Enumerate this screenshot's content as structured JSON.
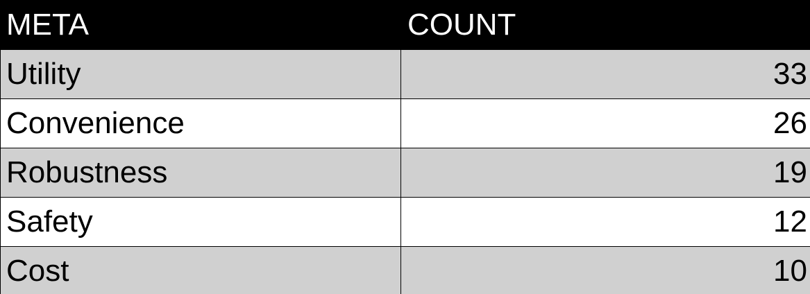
{
  "chart_data": {
    "type": "table",
    "columns": [
      "META",
      "COUNT"
    ],
    "rows": [
      {
        "label": "Utility",
        "value": "33"
      },
      {
        "label": "Convenience",
        "value": "26"
      },
      {
        "label": "Robustness",
        "value": "19"
      },
      {
        "label": "Safety",
        "value": "12"
      },
      {
        "label": "Cost",
        "value": "10"
      }
    ]
  },
  "colors": {
    "header_background": "#000000",
    "header_text": "#ffffff",
    "shaded_row": "#d0d0d0",
    "plain_row": "#ffffff"
  }
}
